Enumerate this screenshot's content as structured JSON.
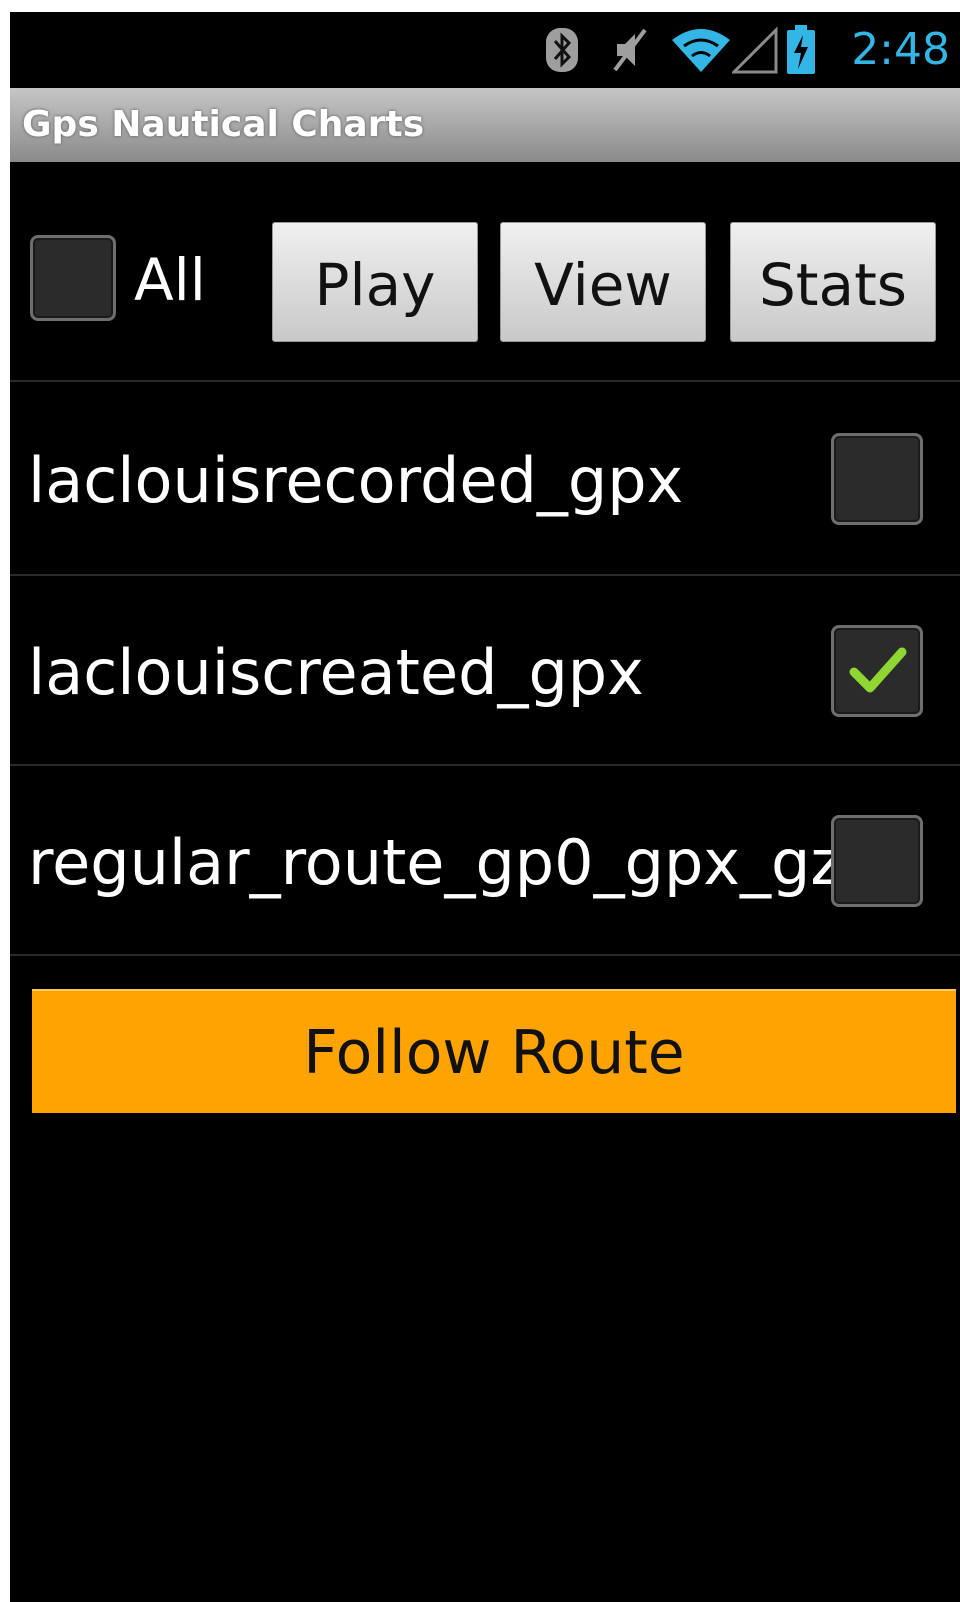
{
  "status_bar": {
    "time": "2:48",
    "icons": [
      "bluetooth-icon",
      "mute-icon",
      "wifi-icon",
      "cell-signal-icon",
      "battery-charging-icon"
    ],
    "accent_color": "#33b5e5"
  },
  "app": {
    "title": "Gps Nautical Charts"
  },
  "toolbar": {
    "all_label": "All",
    "all_checked": false,
    "buttons": [
      "Play",
      "View",
      "Stats"
    ]
  },
  "routes": [
    {
      "name": "laclouisrecorded_gpx",
      "checked": false
    },
    {
      "name": "laclouiscreated_gpx",
      "checked": true
    },
    {
      "name": "regular_route_gp0_gpx_gz",
      "checked": false
    }
  ],
  "follow_button": {
    "label": "Follow Route",
    "color": "#ffa303"
  }
}
